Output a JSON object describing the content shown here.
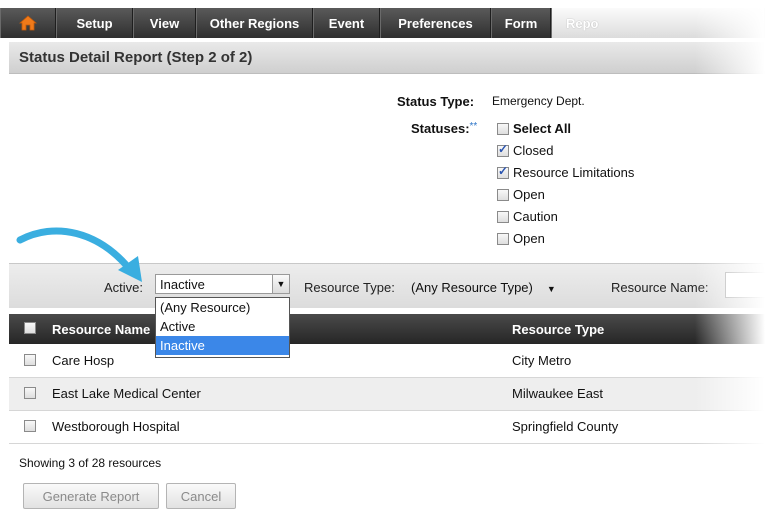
{
  "nav": {
    "items": [
      "Setup",
      "View",
      "Other Regions",
      "Event",
      "Preferences",
      "Form",
      "Repo"
    ]
  },
  "page_title": "Status Detail Report (Step 2 of 2)",
  "status_type": {
    "label": "Status Type:",
    "value": "Emergency Dept."
  },
  "statuses": {
    "label": "Statuses:",
    "required_marker": "**",
    "select_all": "Select All",
    "items": [
      {
        "label": "Closed",
        "checked": true
      },
      {
        "label": "Resource Limitations",
        "checked": true
      },
      {
        "label": "Open",
        "checked": false
      },
      {
        "label": "Caution",
        "checked": false
      },
      {
        "label": "Open",
        "checked": false
      }
    ]
  },
  "filters": {
    "active_label": "Active:",
    "active_value": "Inactive",
    "active_options": [
      "(Any Resource)",
      "Active",
      "Inactive"
    ],
    "resource_type_label": "Resource Type:",
    "resource_type_value": "(Any Resource Type)",
    "resource_name_label": "Resource Name:"
  },
  "table": {
    "headers": [
      "Resource Name",
      "Resource Type"
    ],
    "rows": [
      {
        "name": "Care Hosp",
        "type": "City Metro"
      },
      {
        "name": "East Lake Medical Center",
        "type": "Milwaukee East"
      },
      {
        "name": "Westborough Hospital",
        "type": "Springfield County"
      }
    ]
  },
  "footer": {
    "showing": "Showing 3 of 28 resources",
    "generate_label": "Generate Report",
    "cancel_label": "Cancel"
  },
  "colors": {
    "accent_blue": "#3b87e8",
    "arrow": "#3aaee0",
    "nav_bg": "#3a3a3a"
  }
}
